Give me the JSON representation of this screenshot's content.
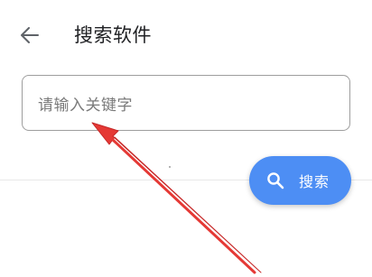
{
  "header": {
    "back_icon": "arrow-left-icon",
    "title": "搜索软件"
  },
  "search": {
    "placeholder": "请输入关键字",
    "value": ""
  },
  "search_button": {
    "icon": "search-icon",
    "label": "搜索",
    "color": "#4d8ef4"
  },
  "annotation": {
    "type": "red-arrow",
    "color": "#e53935",
    "points_to": "search-input"
  }
}
